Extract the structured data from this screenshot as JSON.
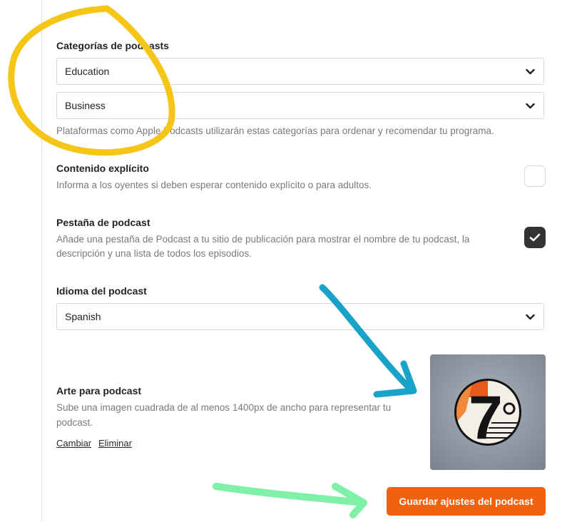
{
  "categories": {
    "label": "Categorías de podcasts",
    "primary": "Education",
    "secondary": "Business",
    "help": "Plataformas como Apple Podcasts utilizarán estas categorías para ordenar y recomendar tu programa."
  },
  "explicit": {
    "label": "Contenido explícito",
    "help": "Informa a los oyentes si deben esperar contenido explícito o para adultos."
  },
  "podcast_tab": {
    "label": "Pestaña de podcast",
    "help_line1": "Añade una pestaña de Podcast a tu sitio de publicación para mostrar el nombre de tu podcast, la",
    "help_line2": "descripción y una lista de todos los episodios."
  },
  "language": {
    "label": "Idioma del podcast",
    "value": "Spanish"
  },
  "artwork": {
    "label": "Arte para podcast",
    "help_line1": "Sube una imagen cuadrada de al menos 1400px de ancho para representar tu",
    "help_line2": "podcast.",
    "change_link": "Cambiar",
    "remove_link": "Eliminar",
    "logo_text": "7"
  },
  "save_button": "Guardar ajustes del podcast",
  "colors": {
    "accent": "#f0620f",
    "highlight_yellow": "#f5c518",
    "highlight_blue": "#1aa3c8",
    "highlight_green": "#7ef0a8"
  }
}
